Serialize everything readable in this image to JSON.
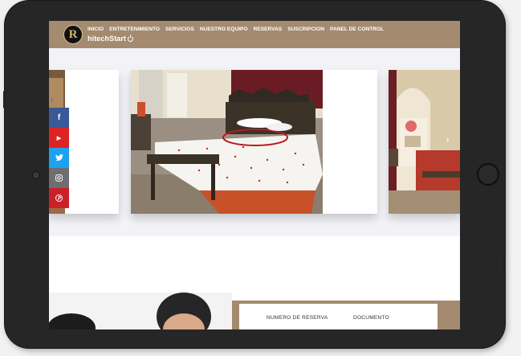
{
  "navbar": {
    "logo_letter": "R",
    "menu": [
      "INICIO",
      "ENTRETENIMIENTO",
      "SERVICIOS",
      "NUESTRO EQUIPO",
      "RESERVAS",
      "SUSCRIPCION",
      "PANEL DE CONTROL"
    ],
    "brand_text": "hitechStart"
  },
  "carousel": {
    "prev_arrow": "‹",
    "next_arrow": "›"
  },
  "social": [
    {
      "glyph": "f",
      "icon": "facebook-icon",
      "color": "#3b5998"
    },
    {
      "glyph": "▶",
      "icon": "youtube-icon",
      "color": "#dd2323"
    },
    {
      "glyph": "🐦",
      "icon": "twitter-icon",
      "color": "#1da1f2"
    },
    {
      "glyph": "◎",
      "icon": "instagram-icon",
      "color": "#6e6e6e"
    },
    {
      "glyph": "P",
      "icon": "pinterest-icon",
      "color": "#cb2027"
    }
  ],
  "reservation_form": {
    "label_reserva": "NUMERO DE RESERVA",
    "label_documento": "DOCUMENTO"
  },
  "colors": {
    "navbar": "#a48a6e",
    "device": "#262626"
  }
}
